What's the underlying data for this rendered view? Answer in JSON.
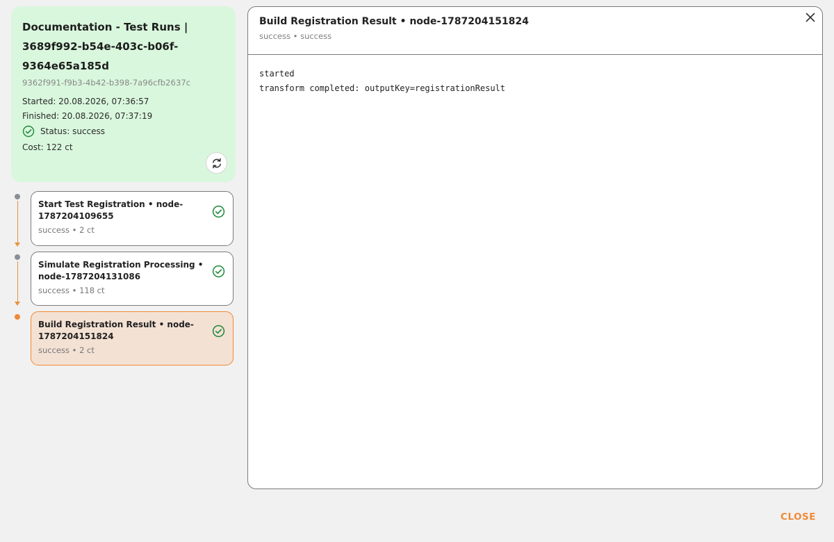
{
  "run": {
    "title": "Documentation - Test Runs | 3689f992-b54e-403c-b06f-9364e65a185d",
    "run_id": "9362f991-f9b3-4b42-b398-7a96cfb2637c",
    "started": "Started: 20.08.2026, 07:36:57",
    "finished": "Finished: 20.08.2026, 07:37:19",
    "status": "Status: success",
    "cost": "Cost: 122 ct",
    "icons": {
      "status": "check-circle-icon",
      "refresh": "refresh-icon"
    }
  },
  "steps": [
    {
      "title": "Start Test Registration • node-1787204109655",
      "sub": "success • 2 ct",
      "state": "done"
    },
    {
      "title": "Simulate Registration Processing • node-1787204131086",
      "sub": "success • 118 ct",
      "state": "done"
    },
    {
      "title": "Build Registration Result • node-1787204151824",
      "sub": "success • 2 ct",
      "state": "active"
    }
  ],
  "detail": {
    "title": "Build Registration Result • node-1787204151824",
    "sub": "success • success",
    "log": [
      "started",
      "transform completed: outputKey=registrationResult"
    ]
  },
  "footer": {
    "close_label": "CLOSE"
  },
  "colors": {
    "accent": "#ef8a36",
    "success": "#1f8a3a",
    "summary_bg": "#d9f7dd",
    "active_bg": "#f3e1d4",
    "dot_done": "#8a8f97"
  }
}
